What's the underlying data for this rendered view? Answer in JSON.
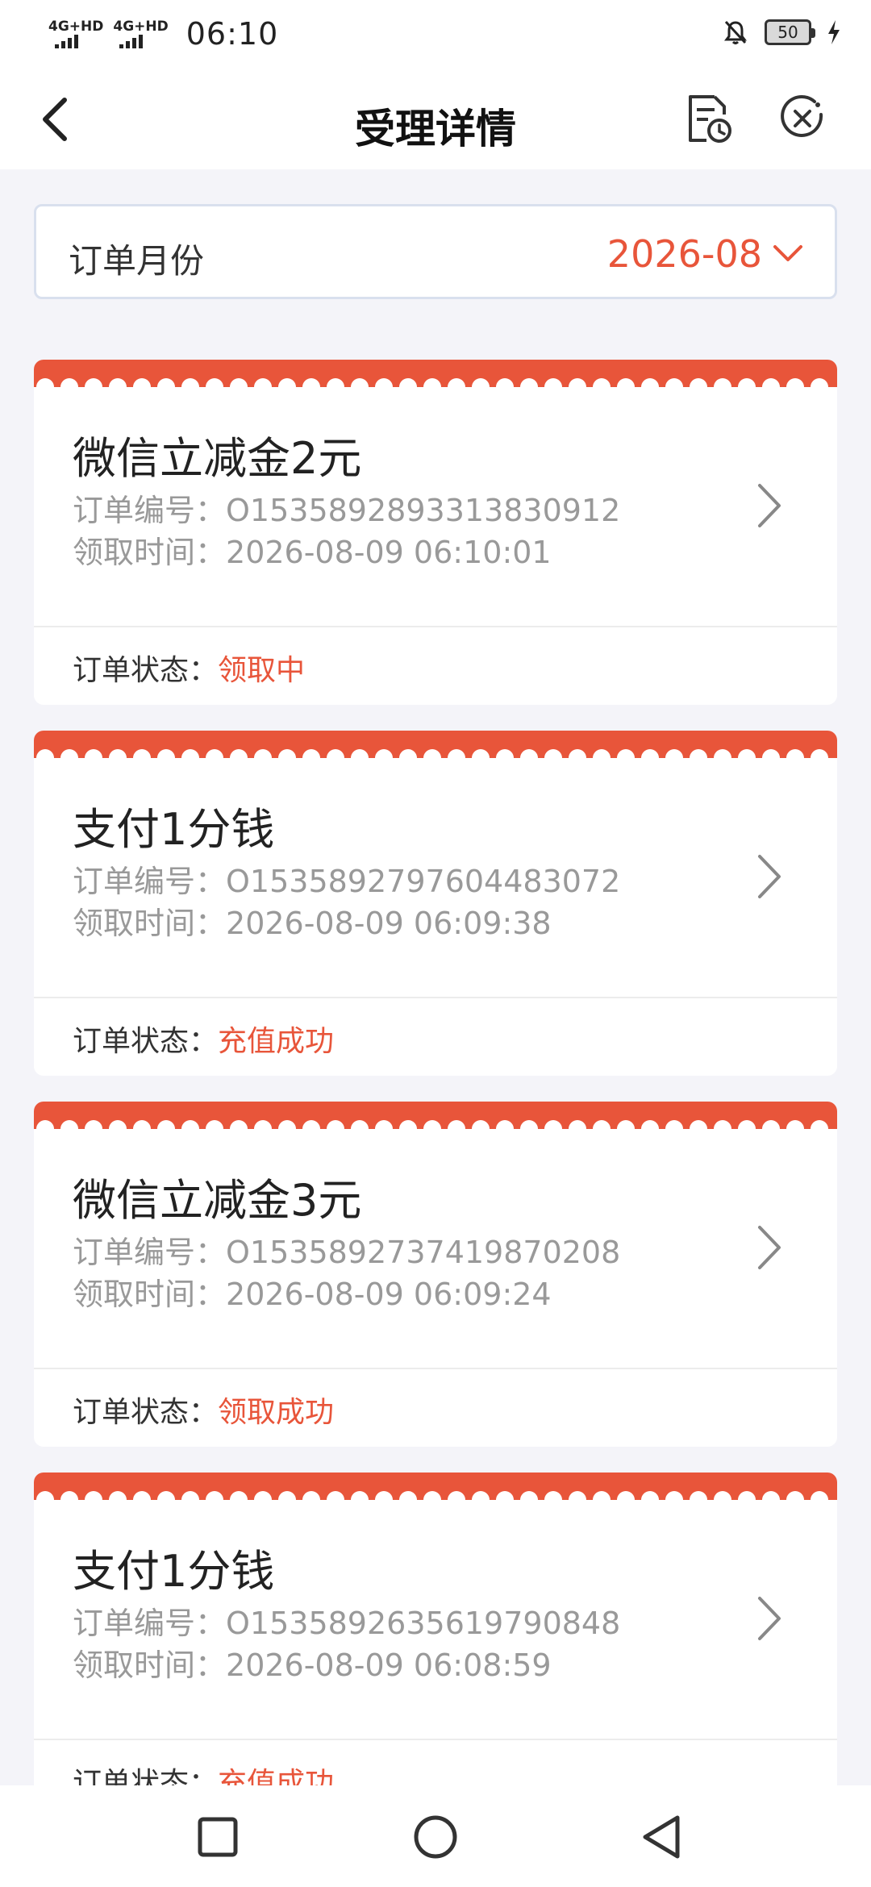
{
  "status_bar": {
    "network1": "4G+HD",
    "network2": "4G+HD",
    "time": "06:10",
    "battery": "50"
  },
  "nav": {
    "title": "受理详情"
  },
  "month_selector": {
    "label": "订单月份",
    "value": "2026-08"
  },
  "orders": [
    {
      "title": "微信立减金2元",
      "order_no_label": "订单编号：",
      "order_no": "O1535892893313830912",
      "time_label": "领取时间：",
      "time": "2026-08-09 06:10:01",
      "status_label": "订单状态：",
      "status": "领取中"
    },
    {
      "title": "支付1分钱",
      "order_no_label": "订单编号：",
      "order_no": "O1535892797604483072",
      "time_label": "领取时间：",
      "time": "2026-08-09 06:09:38",
      "status_label": "订单状态：",
      "status": "充值成功"
    },
    {
      "title": "微信立减金3元",
      "order_no_label": "订单编号：",
      "order_no": "O1535892737419870208",
      "time_label": "领取时间：",
      "time": "2026-08-09 06:09:24",
      "status_label": "订单状态：",
      "status": "领取成功"
    },
    {
      "title": "支付1分钱",
      "order_no_label": "订单编号：",
      "order_no": "O1535892635619790848",
      "time_label": "领取时间：",
      "time": "2026-08-09 06:08:59",
      "status_label": "订单状态：",
      "status": "充值成功"
    }
  ],
  "colors": {
    "accent": "#e8553a",
    "background": "#f4f4f9"
  },
  "icons": {
    "back": "back-arrow-icon",
    "history": "order-history-icon",
    "close": "close-circle-icon",
    "chevron": "chevron-down-icon",
    "card_arrow": "chevron-right-icon"
  }
}
